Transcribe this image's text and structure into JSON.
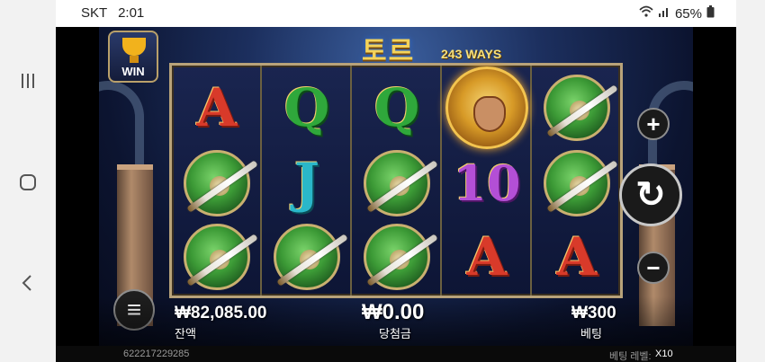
{
  "status_bar": {
    "carrier": "SKT",
    "time": "2:01",
    "battery": "65%"
  },
  "game": {
    "title": "토르",
    "ways_label": "243 WAYS",
    "win_badge_label": "WIN",
    "reels": [
      [
        "A",
        "shield",
        "shield"
      ],
      [
        "Q",
        "J",
        "shield"
      ],
      [
        "Q",
        "shield",
        "shield"
      ],
      [
        "thor",
        "10",
        "A"
      ],
      [
        "shield",
        "shield",
        "A"
      ]
    ],
    "hud": {
      "balance_value": "₩82,085.00",
      "balance_label": "잔액",
      "win_value": "₩0.00",
      "win_label": "당첨금",
      "bet_value": "₩300",
      "bet_label": "베팅"
    },
    "footer": {
      "round_id": "622217229285",
      "bet_level_label": "베팅 레벨:",
      "bet_level_value": "X10"
    },
    "controls": {
      "plus": "+",
      "minus": "−",
      "menu": "≡",
      "spin": "↻"
    }
  },
  "icons": [
    "wifi-icon",
    "signal-icon",
    "battery-icon",
    "recent-apps-icon",
    "home-icon",
    "back-icon"
  ]
}
